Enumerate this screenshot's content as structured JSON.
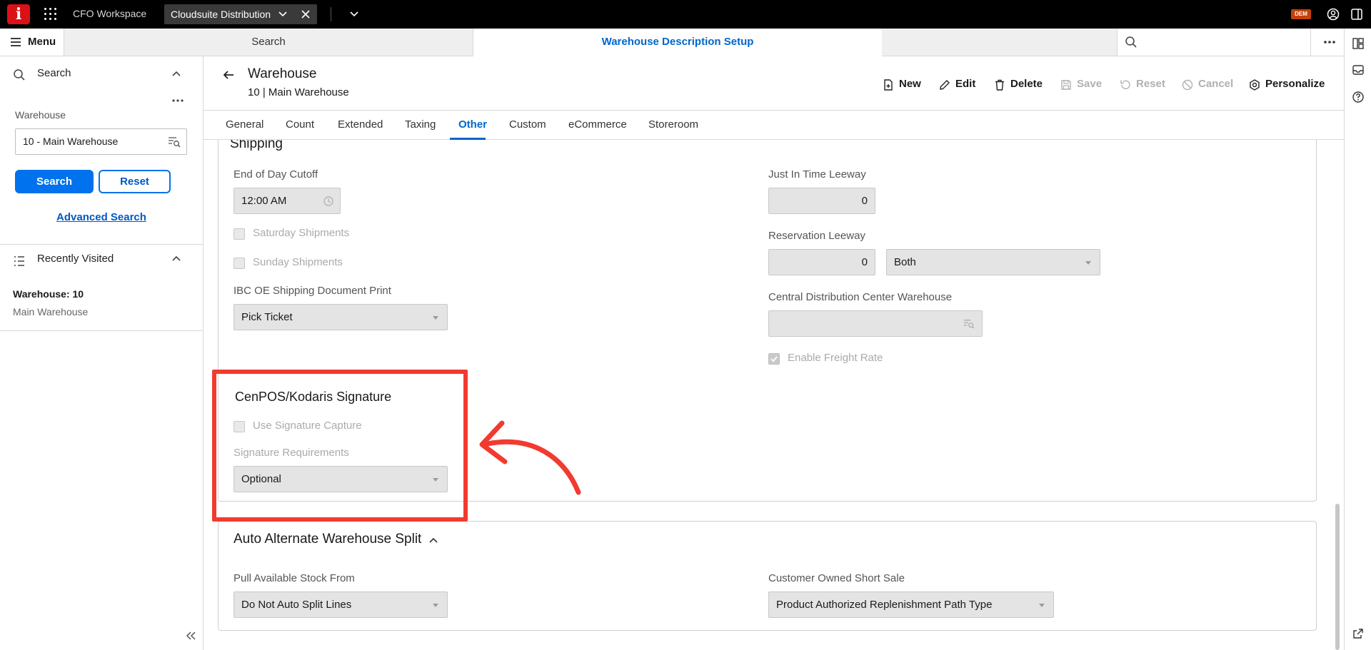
{
  "topbar": {
    "logo_letter": "i",
    "workspace": "CFO Workspace",
    "active_app": "Cloudsuite Distribution",
    "env_badge": "DEM"
  },
  "secbar": {
    "menu_label": "Menu",
    "search_tab": "Search",
    "active_tab": "Warehouse Description Setup"
  },
  "sidebar": {
    "search_title": "Search",
    "warehouse_label": "Warehouse",
    "warehouse_value": "10 - Main Warehouse",
    "search_button": "Search",
    "reset_button": "Reset",
    "advanced_search": "Advanced Search",
    "recent_title": "Recently Visited",
    "recent_items": [
      {
        "title": "Warehouse: 10",
        "subtitle": "Main Warehouse"
      }
    ]
  },
  "header": {
    "title": "Warehouse",
    "subtitle": "10 | Main Warehouse",
    "actions": {
      "new": "New",
      "edit": "Edit",
      "delete": "Delete",
      "save": "Save",
      "reset": "Reset",
      "cancel": "Cancel",
      "personalize": "Personalize"
    }
  },
  "tabs": [
    "General",
    "Count",
    "Extended",
    "Taxing",
    "Other",
    "Custom",
    "eCommerce",
    "Storeroom"
  ],
  "active_tab": "Other",
  "shipping": {
    "clipped_heading": "Shipping",
    "end_of_day_label": "End of Day Cutoff",
    "end_of_day_value": "12:00 AM",
    "saturday_label": "Saturday Shipments",
    "saturday_checked": false,
    "sunday_label": "Sunday Shipments",
    "sunday_checked": false,
    "ibc_label": "IBC OE Shipping Document Print",
    "ibc_value": "Pick Ticket",
    "jit_label": "Just In Time Leeway",
    "jit_value": "0",
    "reservation_label": "Reservation Leeway",
    "reservation_value": "0",
    "reservation_type": "Both",
    "cdc_label": "Central Distribution Center Warehouse",
    "cdc_value": "",
    "freight_label": "Enable Freight Rate",
    "freight_checked": true
  },
  "signature": {
    "title": "CenPOS/Kodaris Signature",
    "use_capture_label": "Use Signature Capture",
    "use_capture_checked": false,
    "requirements_label": "Signature Requirements",
    "requirements_value": "Optional"
  },
  "auto_split": {
    "title": "Auto Alternate Warehouse Split",
    "pull_label": "Pull Available Stock From",
    "pull_value": "Do Not Auto Split Lines",
    "cos_label": "Customer Owned Short Sale",
    "cos_value": "Product Authorized Replenishment Path Type"
  },
  "colors": {
    "accent": "#0066cc",
    "annotation": "#f23a30",
    "topbar": "#000000",
    "logo": "#da1217"
  }
}
